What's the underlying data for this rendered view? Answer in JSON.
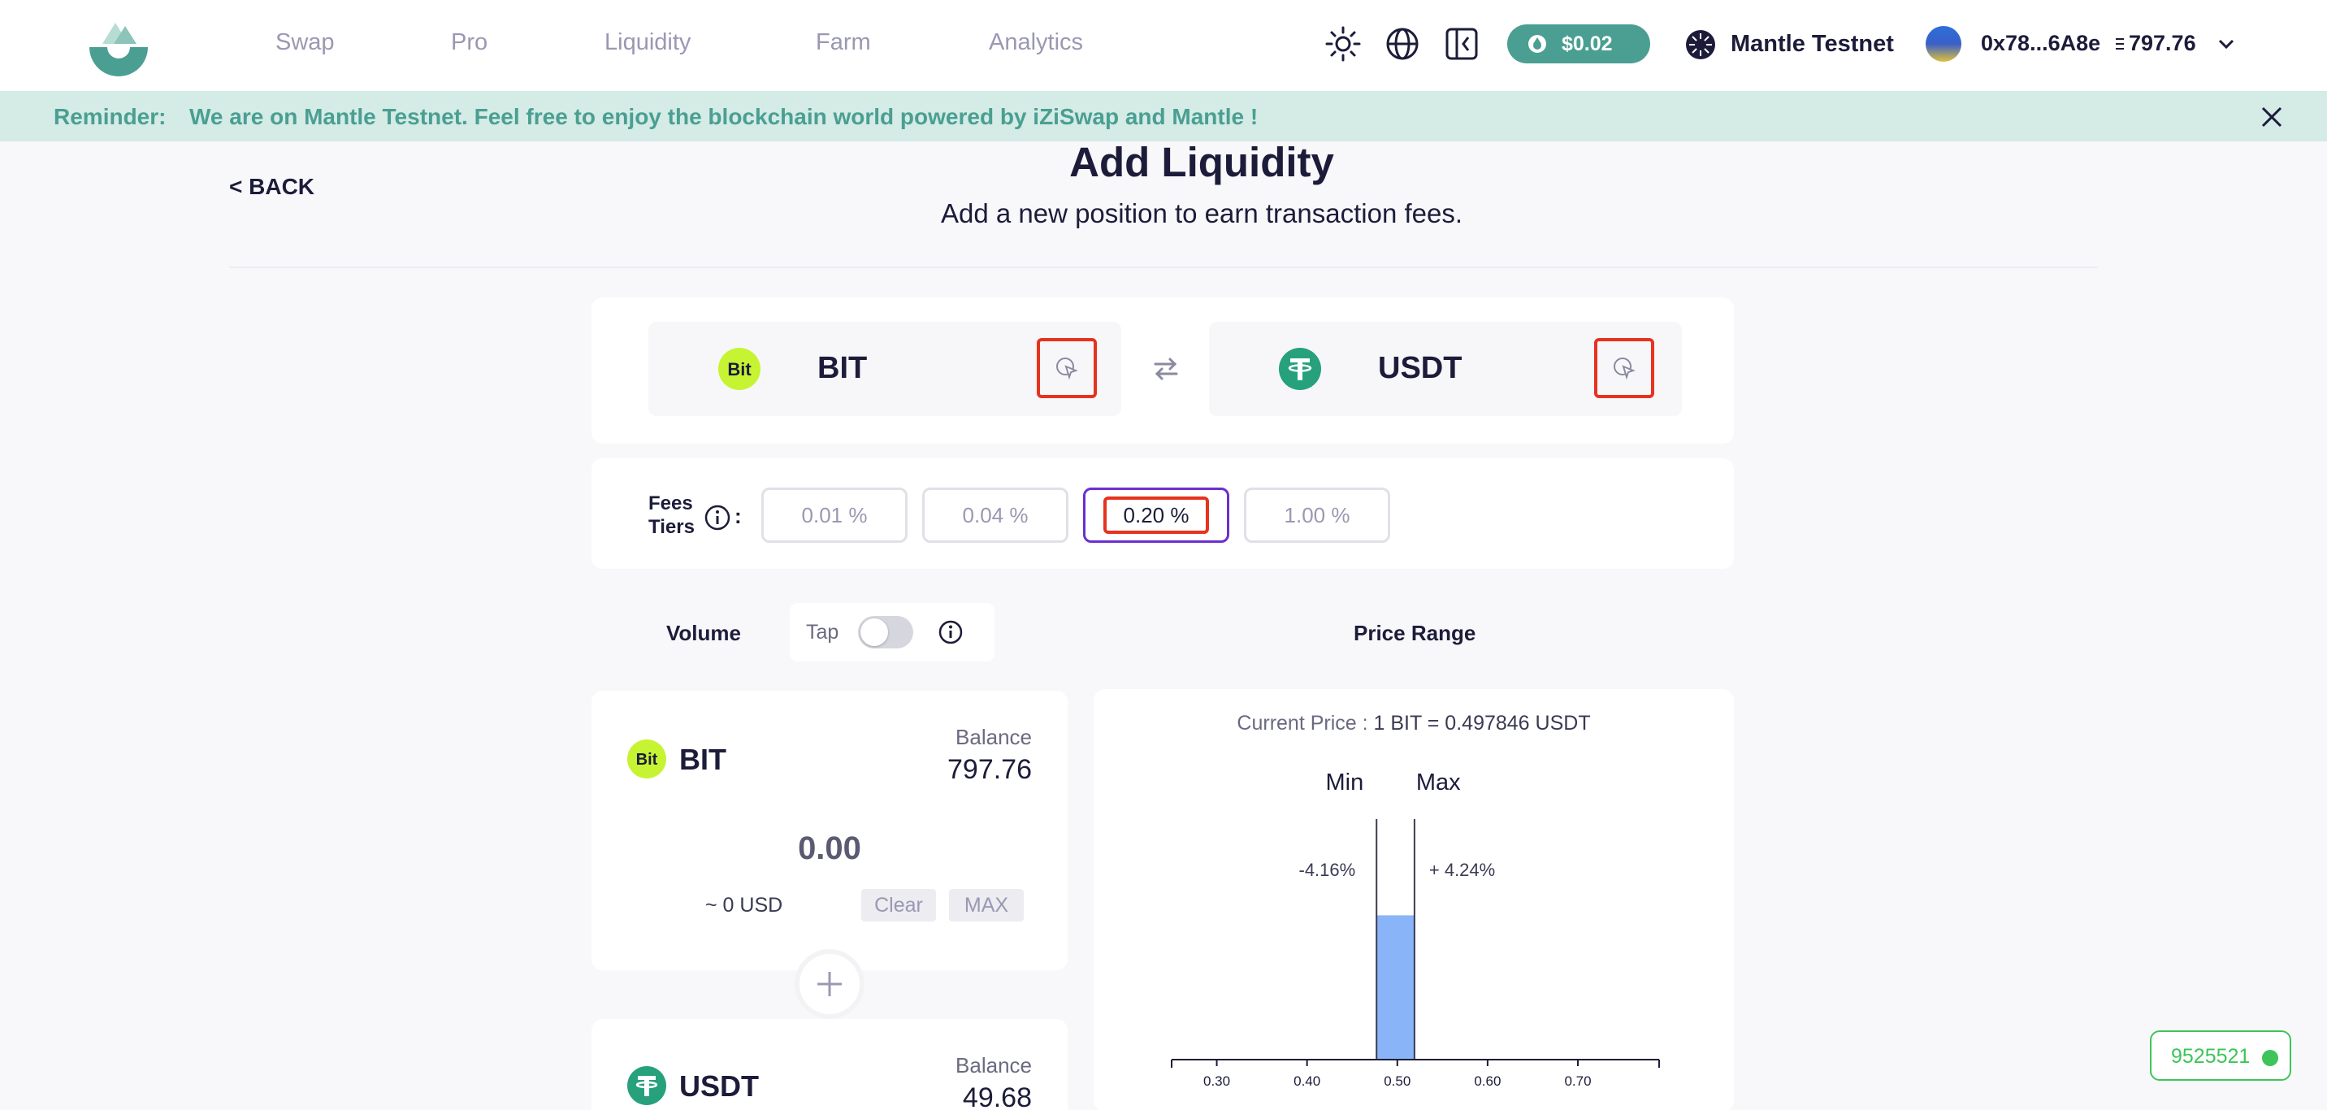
{
  "nav": {
    "items": [
      "Swap",
      "Pro",
      "Liquidity",
      "Farm",
      "Analytics"
    ],
    "price_badge": "$0.02",
    "network": "Mantle Testnet",
    "wallet_address": "0x78...6A8e",
    "wallet_balance": "797.76",
    "icons": [
      "sun-icon",
      "globe-icon",
      "collapse-sidebar-icon",
      "izi-token-icon",
      "mantle-network-icon",
      "chevron-down-icon"
    ]
  },
  "reminder": {
    "label": "Reminder:",
    "text": "We are on Mantle Testnet. Feel free to enjoy the blockchain world powered by iZiSwap and Mantle !"
  },
  "header": {
    "back": "< BACK",
    "title": "Add Liquidity",
    "subtitle": "Add a new position to earn transaction fees."
  },
  "pair": {
    "token_a": "BIT",
    "token_b": "USDT"
  },
  "fees": {
    "label_line1": "Fees",
    "label_line2": "Tiers",
    "colon": ":",
    "tiers": [
      "0.01 %",
      "0.04 %",
      "0.20 %",
      "1.00 %"
    ],
    "selected": "0.20 %"
  },
  "volume": {
    "label": "Volume",
    "tap_label": "Tap",
    "tap_enabled": false
  },
  "price_range": {
    "label": "Price Range",
    "current_price_label": "Current Price :",
    "current_price_value": "1 BIT = 0.497846 USDT",
    "min_label": "Min",
    "max_label": "Max",
    "min_pct": "-4.16%",
    "max_pct": "+ 4.24%"
  },
  "deposit": {
    "bit": {
      "symbol": "BIT",
      "balance_label": "Balance",
      "balance": "797.76",
      "amount": "0.00",
      "usd": "~ 0 USD",
      "clear": "Clear",
      "max": "MAX"
    },
    "usdt": {
      "symbol": "USDT",
      "balance_label": "Balance",
      "balance": "49.68"
    }
  },
  "block_number": "9525521",
  "colors": {
    "brand_teal": "#4a9f92",
    "reminder_bg": "#d4ebe6",
    "selected_fee_border": "#6b2fd0",
    "highlight_red": "#e5331f",
    "liquidity_bar": "#8ab4f8",
    "block_green": "#3ec45a",
    "bit_green": "#c6f432",
    "usdt_green": "#26a17b"
  },
  "chart_data": {
    "type": "bar",
    "x_ticks": [
      "0.30",
      "0.40",
      "0.50",
      "0.60",
      "0.70"
    ],
    "xlim": [
      0.25,
      0.79
    ],
    "current_price": 0.497846,
    "min_price": 0.477,
    "max_price": 0.519,
    "liquidity_bar": {
      "x_start": 0.477,
      "x_end": 0.519,
      "relative_height": 0.6
    }
  }
}
